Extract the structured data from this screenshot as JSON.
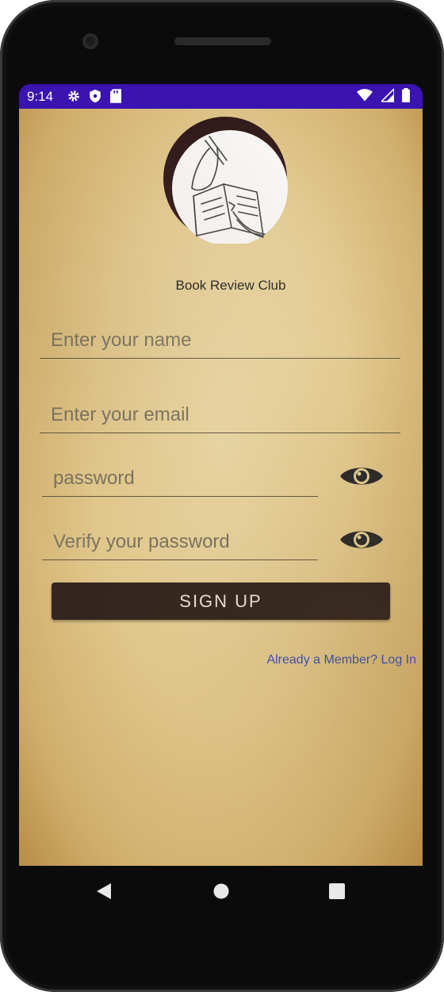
{
  "status_bar": {
    "time": "9:14",
    "left_icons": [
      "gear-icon",
      "shield-icon",
      "sd-card-icon"
    ],
    "right_icons": [
      "wifi-icon",
      "signal-icon",
      "battery-icon"
    ],
    "color": "#3a13b0"
  },
  "app": {
    "title": "Book Review Club",
    "logo": "book-hand-illustration"
  },
  "form": {
    "name_placeholder": "Enter your name",
    "email_placeholder": "Enter your email",
    "password_placeholder": "password",
    "verify_placeholder": "Verify your password",
    "signup_label": "SIGN UP",
    "login_link": "Already a Member? Log In"
  },
  "colors": {
    "button": "#33261f",
    "link": "#3d4fb0"
  },
  "nav": {
    "icons": [
      "back-icon",
      "home-icon",
      "recent-apps-icon"
    ]
  }
}
